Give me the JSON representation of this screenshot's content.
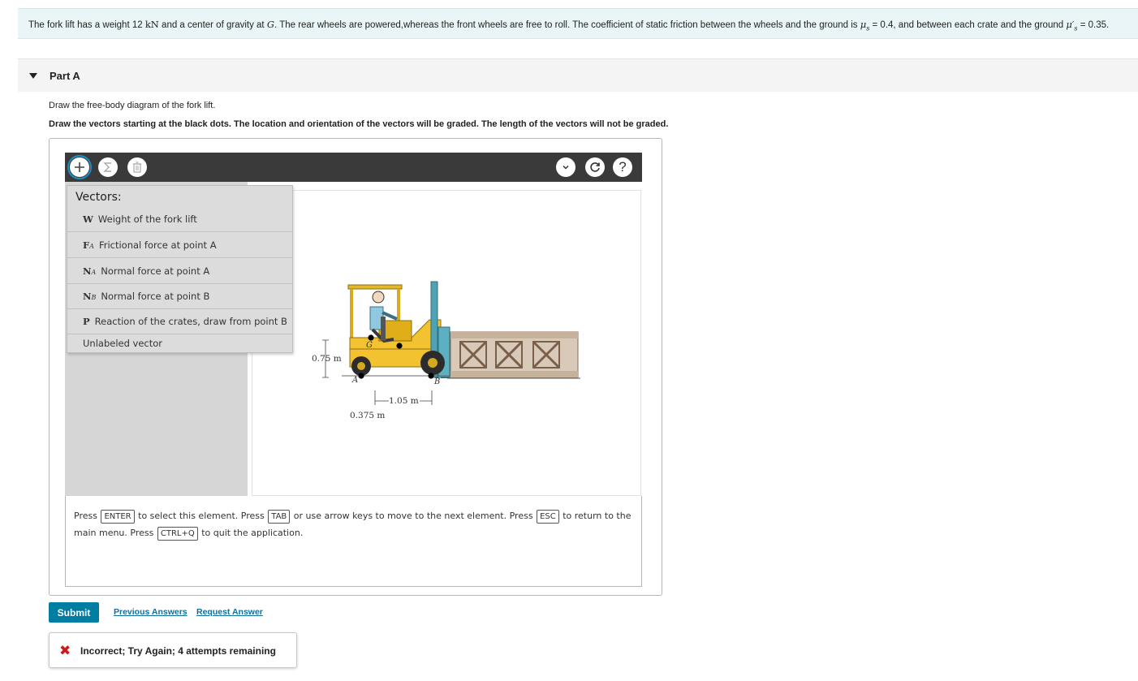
{
  "problem": {
    "p1": "The fork lift has a weight 12 ",
    "unit": "kN",
    "p2": " and a center of gravity at ",
    "g": "G",
    "p3": ". The rear wheels are powered,whereas the front wheels are free to roll. The coefficient of static friction between the wheels and the ground is ",
    "mu": "μ",
    "mu_sub": "s",
    "p4": " = 0.4, and between each crate and the ground ",
    "mu2": "μ′",
    "mu2_sub": "s",
    "p5": " = 0.35."
  },
  "part": {
    "label": "Part A"
  },
  "instructions": {
    "line1": "Draw the free-body diagram of the fork lift.",
    "line2": "Draw the vectors starting at the black dots. The location and orientation of the vectors will be graded. The length of the vectors will not be graded."
  },
  "toolbar": {
    "help_label": "?"
  },
  "vectors_menu": {
    "title": "Vectors:",
    "items": [
      {
        "symbol": "W",
        "sub": "",
        "label": "Weight of the fork lift"
      },
      {
        "symbol": "F",
        "sub": "A",
        "label": "Frictional force at point A"
      },
      {
        "symbol": "N",
        "sub": "A",
        "label": "Normal force at point A"
      },
      {
        "symbol": "N",
        "sub": "B",
        "label": "Normal force at point B"
      },
      {
        "symbol": "P",
        "sub": "",
        "label": "Reaction of the crates, draw from point B"
      }
    ],
    "unlabeled": "Unlabeled vector"
  },
  "diagram": {
    "dim_height": "0.75 m",
    "dim_wheelbase": "1.05 m",
    "dim_offset": "0.375 m",
    "label_g": "G",
    "label_a": "A",
    "label_b": "B"
  },
  "keyhelp": {
    "t1": "Press ",
    "k1": "ENTER",
    "t2": " to select this element. Press ",
    "k2": "TAB",
    "t3": " or use arrow keys to move to the next element. Press ",
    "k3": "ESC",
    "t4": " to return to the main menu. Press ",
    "k4": "CTRL+Q",
    "t5": " to quit the application."
  },
  "actions": {
    "submit": "Submit",
    "previous": "Previous Answers",
    "request": "Request Answer"
  },
  "feedback": {
    "icon": "✖",
    "text": "Incorrect; Try Again; 4 attempts remaining"
  },
  "colors": {
    "teal_bar": "#e9f5f6",
    "toolbar": "#3a3a3a",
    "submit": "#007da3",
    "link": "#0d6f9a",
    "error": "#d01a1a",
    "forklift": "#f2c230"
  }
}
